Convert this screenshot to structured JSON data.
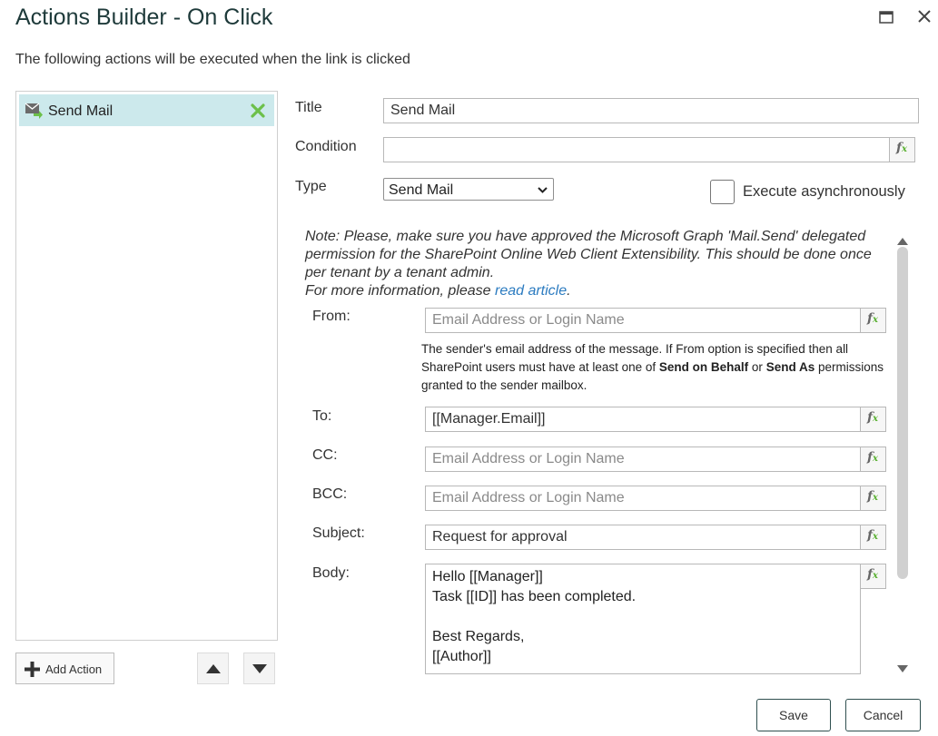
{
  "window": {
    "title": "Actions Builder - On Click",
    "subtitle": "The following actions will be executed when the link is clicked"
  },
  "action_list": {
    "items": [
      {
        "label": "Send Mail",
        "selected": true
      }
    ],
    "add_label": "Add Action"
  },
  "form": {
    "title_label": "Title",
    "title_value": "Send Mail",
    "condition_label": "Condition",
    "condition_value": "",
    "type_label": "Type",
    "type_value": "Send Mail",
    "async_label": "Execute asynchronously",
    "async_checked": false
  },
  "note": {
    "text": "Note: Please, make sure you have approved the Microsoft Graph 'Mail.Send' delegated permission for the SharePoint Online Web Client Extensibility. This should be done once per tenant by a tenant admin.",
    "more_prefix": "For more information, please ",
    "link_text": "read article",
    "more_suffix": "."
  },
  "mail": {
    "from_label": "From:",
    "from_placeholder": "Email Address or Login Name",
    "from_help_1": "The sender's email address of the message. If From option is specified then all SharePoint users must have at least one of ",
    "from_help_bold_1": "Send on Behalf",
    "from_help_2": " or ",
    "from_help_bold_2": "Send As",
    "from_help_3": " permissions granted to the sender mailbox.",
    "to_label": "To:",
    "to_value": "[[Manager.Email]]",
    "cc_label": "CC:",
    "cc_placeholder": "Email Address or Login Name",
    "bcc_label": "BCC:",
    "bcc_placeholder": "Email Address or Login Name",
    "subject_label": "Subject:",
    "subject_value": "Request for approval",
    "body_label": "Body:",
    "body_value": "Hello [[Manager]]\nTask [[ID]] has been completed.\n\nBest Regards,\n[[Author]]"
  },
  "buttons": {
    "save": "Save",
    "cancel": "Cancel"
  },
  "icons": {
    "maximize": "maximize-icon",
    "close": "close-icon",
    "action_item": "send-mail-icon",
    "remove_action": "remove-x-icon",
    "add": "plus-icon",
    "move_up": "triangle-up-icon",
    "move_down": "triangle-down-icon",
    "formula": "fx-icon"
  },
  "colors": {
    "selected_item_bg": "#cce9ec",
    "remove_x": "#6cc04a",
    "link": "#2b7bc0",
    "button_border": "#2f4f4f"
  }
}
